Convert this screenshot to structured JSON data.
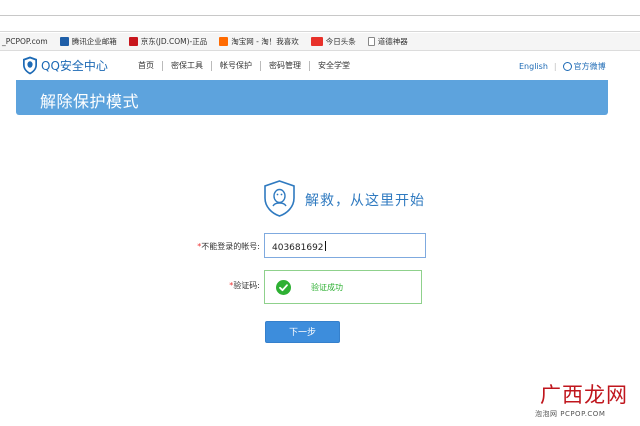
{
  "bookmarks": [
    {
      "label": "_PCPOP.com",
      "icon": "none"
    },
    {
      "label": "腾讯企业邮箱",
      "icon": "blue"
    },
    {
      "label": "京东(JD.COM)-正品",
      "icon": "red"
    },
    {
      "label": "淘宝网 - 淘！我喜欢",
      "icon": "orange"
    },
    {
      "label": "今日头条",
      "icon": "red2"
    },
    {
      "label": "道德神器",
      "icon": "doc"
    }
  ],
  "header": {
    "logo_text": "QQ安全中心",
    "nav": [
      "首页",
      "密保工具",
      "帐号保护",
      "密码管理",
      "安全学堂"
    ],
    "english_link": "English",
    "weibo_link": "官方微博"
  },
  "banner": {
    "title": "解除保护模式"
  },
  "hero": {
    "title": "解救，从这里开始"
  },
  "form": {
    "account_label_star": "*",
    "account_label": "不能登录的帐号:",
    "account_value": "403681692",
    "code_label_star": "*",
    "code_label": "验证码:",
    "verify_status": "验证成功",
    "next_button": "下一步"
  },
  "watermark": {
    "main": "广西龙网",
    "sub": "泡泡网 PCPOP.COM"
  },
  "colors": {
    "accent": "#5da3dd",
    "button": "#3d8ddc",
    "success": "#2eb033",
    "link": "#1d6ab5"
  }
}
